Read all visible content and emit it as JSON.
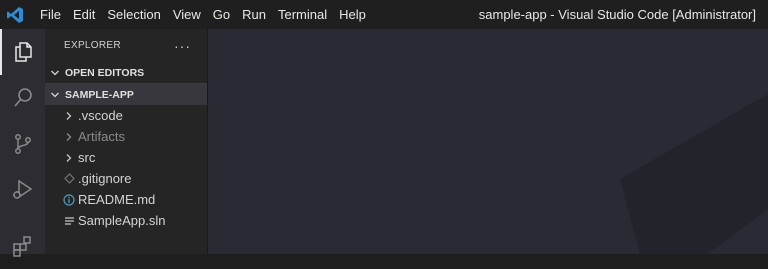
{
  "titlebar": {
    "menu": [
      "File",
      "Edit",
      "Selection",
      "View",
      "Go",
      "Run",
      "Terminal",
      "Help"
    ],
    "window_title": "sample-app - Visual Studio Code [Administrator]",
    "logo_icon": "vscode-logo-icon",
    "accent": "#2d8bd8"
  },
  "activitybar": {
    "items": [
      {
        "icon": "files-icon",
        "active": true
      },
      {
        "icon": "search-icon",
        "active": false
      },
      {
        "icon": "source-control-icon",
        "active": false
      },
      {
        "icon": "run-debug-icon",
        "active": false
      },
      {
        "icon": "extensions-icon",
        "active": false
      }
    ]
  },
  "sidebar": {
    "title": "EXPLORER",
    "more_label": "···",
    "open_editors": "OPEN EDITORS",
    "project": "SAMPLE-APP",
    "tree": [
      {
        "label": ".vscode",
        "kind": "folder"
      },
      {
        "label": "Artifacts",
        "kind": "folder",
        "dim": true
      },
      {
        "label": "src",
        "kind": "folder"
      },
      {
        "label": ".gitignore",
        "kind": "file",
        "icon": "git-diamond-icon"
      },
      {
        "label": "README.md",
        "kind": "file",
        "icon": "info-icon"
      },
      {
        "label": "SampleApp.sln",
        "kind": "file",
        "icon": "lines-icon"
      }
    ]
  },
  "editor": {
    "background": "#2a2a34",
    "watermark": "vscode-watermark-logo"
  }
}
